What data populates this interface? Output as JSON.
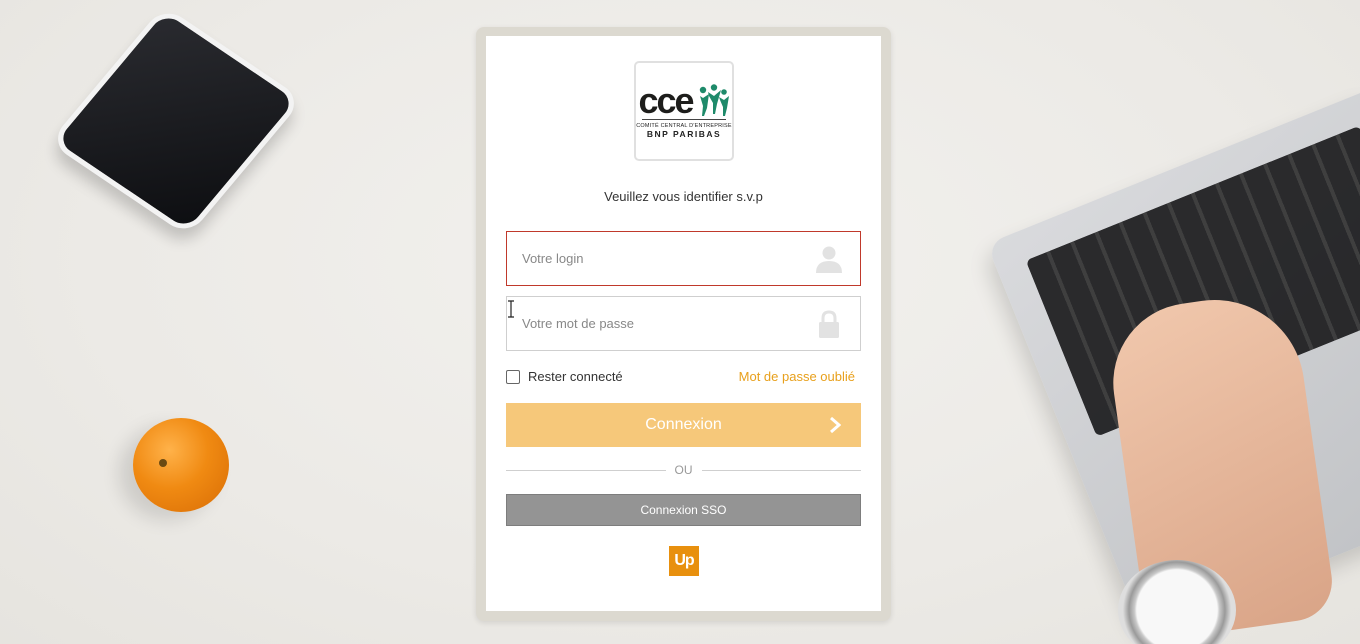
{
  "logo": {
    "brand": "cce",
    "subtitle": "COMITÉ CENTRAL D'ENTREPRISE",
    "company": "BNP PARIBAS",
    "people_color": "#1e8a6a"
  },
  "prompt": "Veuillez vous identifier s.v.p",
  "login_field": {
    "placeholder": "Votre login",
    "value": "",
    "icon": "user-icon"
  },
  "password_field": {
    "placeholder": "Votre mot de passe",
    "value": "",
    "icon": "lock-icon"
  },
  "remember": {
    "label": "Rester connecté",
    "checked": false
  },
  "forgot_link": "Mot de passe oublié",
  "connect_button": {
    "label": "Connexion",
    "icon": "chevron-right-icon"
  },
  "divider_text": "OU",
  "sso_button": "Connexion SSO",
  "footer_logo": "Up",
  "colors": {
    "accent": "#e8a01c",
    "connect_bg": "#f6c87a",
    "sso_bg": "#949494",
    "error_border": "#c0392b",
    "up_logo": "#e8900e"
  }
}
